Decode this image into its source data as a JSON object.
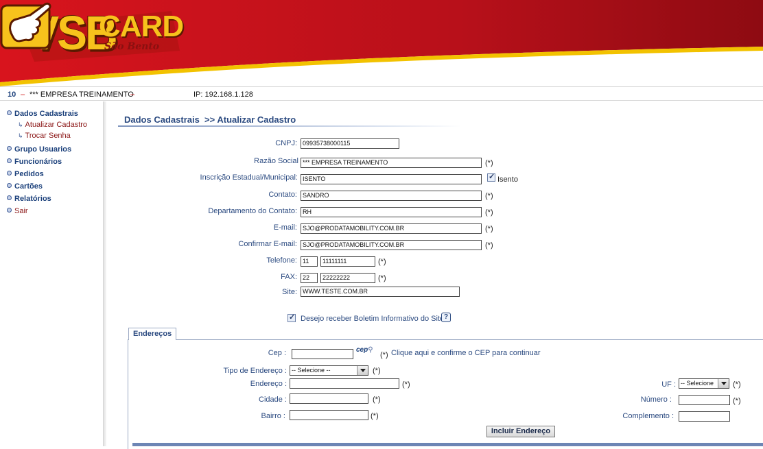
{
  "header": {
    "logo_main": "VSB",
    "logo_card": "CARD",
    "logo_sub": "São Bento",
    "colors": {
      "banner_red": "#c1121b",
      "banner_dark": "#8e0b12",
      "logo_yellow": "#f7c21c"
    }
  },
  "status": {
    "id": "10",
    "dash": "–",
    "company": "*** EMPRESA TREINAMENTO",
    "ip": "IP: 192.168.1.128"
  },
  "sidebar": {
    "items": [
      {
        "label": "Dados Cadastrais"
      },
      {
        "label": "Grupo Usuarios"
      },
      {
        "label": "Funcionários"
      },
      {
        "label": "Pedidos"
      },
      {
        "label": "Cartões"
      },
      {
        "label": "Relatórios"
      },
      {
        "label": "Sair"
      }
    ],
    "subitems": [
      {
        "label": "Atualizar Cadastro"
      },
      {
        "label": "Trocar Senha"
      }
    ]
  },
  "page": {
    "title": "Dados Cadastrais  >> Atualizar Cadastro"
  },
  "form": {
    "required_mark": "(*)",
    "cnpj": {
      "label": "CNPJ:",
      "value": "09935738000115"
    },
    "razao_social": {
      "label": "Razão Social",
      "value": "*** EMPRESA TREINAMENTO"
    },
    "inscricao": {
      "label": "Inscrição Estadual/Municipal:",
      "value": "ISENTO",
      "isento_label": "Isento",
      "isento_checked": true
    },
    "contato": {
      "label": "Contato:",
      "value": "SANDRO"
    },
    "departamento": {
      "label": "Departamento do Contato:",
      "value": "RH"
    },
    "email": {
      "label": "E-mail:",
      "value": "SJO@PRODATAMOBILITY.COM.BR"
    },
    "confirmar_email": {
      "label": "Confirmar E-mail:",
      "value": "SJO@PRODATAMOBILITY.COM.BR"
    },
    "telefone": {
      "label": "Telefone:",
      "ddd": "11",
      "number": "11111111"
    },
    "fax": {
      "label": "FAX:",
      "ddd": "22",
      "number": "22222222"
    },
    "site": {
      "label": "Site:",
      "value": "WWW.TESTE.COM.BR"
    },
    "boletim": {
      "label": "Desejo receber Boletim Informativo do Site",
      "checked": true,
      "help": "?"
    }
  },
  "enderecos": {
    "tab_label": "Endereços",
    "cep": {
      "label": "Cep :",
      "value": "",
      "icon_text": "cep",
      "link": "Clique aqui e confirme o CEP para continuar"
    },
    "tipo": {
      "label": "Tipo de Endereço :",
      "selected": "-- Selecione --"
    },
    "endereco": {
      "label": "Endereço :",
      "value": ""
    },
    "uf": {
      "label": "UF :",
      "selected": "-- Selecione"
    },
    "cidade": {
      "label": "Cidade :",
      "value": ""
    },
    "numero": {
      "label": "Número :",
      "value": ""
    },
    "bairro": {
      "label": "Bairro :",
      "value": ""
    },
    "complemento": {
      "label": "Complemento :",
      "value": ""
    },
    "button_label": "Incluir Endereço"
  }
}
